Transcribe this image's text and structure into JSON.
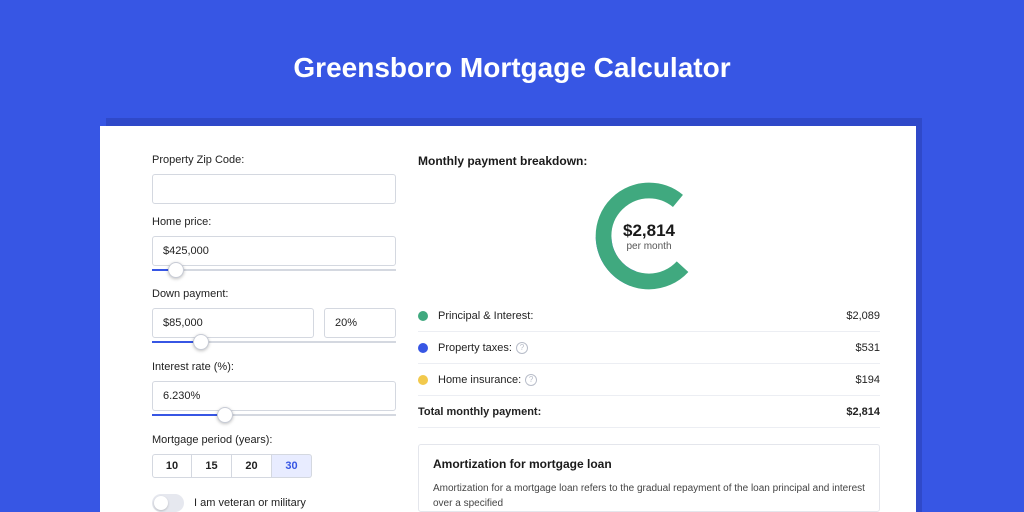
{
  "title": "Greensboro Mortgage Calculator",
  "colors": {
    "green": "#40a97f",
    "blue": "#3756e4",
    "yellow": "#f2c94c"
  },
  "left": {
    "zip": {
      "label": "Property Zip Code:",
      "value": ""
    },
    "price": {
      "label": "Home price:",
      "value": "$425,000",
      "slider_pct": 10
    },
    "down": {
      "label": "Down payment:",
      "value": "$85,000",
      "pct_value": "20%",
      "slider_pct": 20
    },
    "rate": {
      "label": "Interest rate (%):",
      "value": "6.230%",
      "slider_pct": 30
    },
    "period": {
      "label": "Mortgage period (years):",
      "options": [
        "10",
        "15",
        "20",
        "30"
      ],
      "active": "30"
    },
    "veteran": {
      "label": "I am veteran or military",
      "on": false
    }
  },
  "right": {
    "title": "Monthly payment breakdown:",
    "donut": {
      "total_label": "$2,814",
      "sub": "per month"
    },
    "items": [
      {
        "label": "Principal & Interest:",
        "value": "$2,089",
        "color": "#40a97f",
        "info": false
      },
      {
        "label": "Property taxes:",
        "value": "$531",
        "color": "#3756e4",
        "info": true
      },
      {
        "label": "Home insurance:",
        "value": "$194",
        "color": "#f2c94c",
        "info": true
      }
    ],
    "total": {
      "label": "Total monthly payment:",
      "value": "$2,814"
    },
    "amort": {
      "title": "Amortization for mortgage loan",
      "text": "Amortization for a mortgage loan refers to the gradual repayment of the loan principal and interest over a specified"
    }
  },
  "chart_data": {
    "type": "pie",
    "title": "Monthly payment breakdown",
    "series": [
      {
        "name": "Principal & Interest",
        "value": 2089,
        "color": "#40a97f"
      },
      {
        "name": "Property taxes",
        "value": 531,
        "color": "#3756e4"
      },
      {
        "name": "Home insurance",
        "value": 194,
        "color": "#f2c94c"
      }
    ],
    "total": 2814,
    "start_angle_deg": -45
  }
}
